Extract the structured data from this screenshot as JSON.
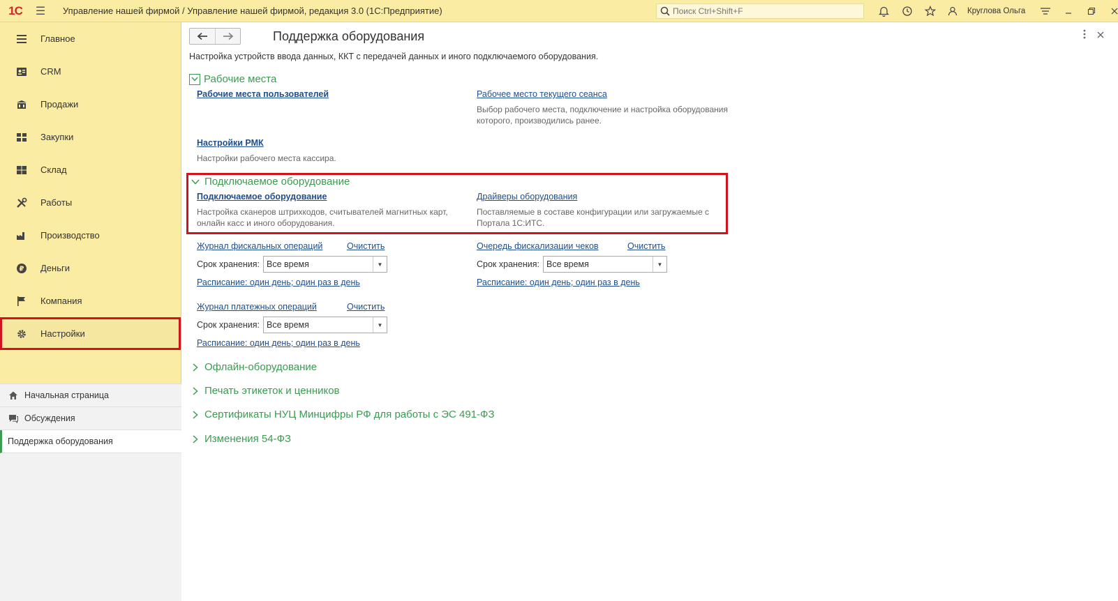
{
  "titlebar": {
    "logo": "1С",
    "app_title": "Управление нашей фирмой / Управление нашей фирмой, редакция 3.0  (1С:Предприятие)",
    "search_placeholder": "Поиск Ctrl+Shift+F",
    "username": "Круглова Ольга"
  },
  "sidebar": {
    "items": [
      {
        "label": "Главное",
        "icon": "menu-icon"
      },
      {
        "label": "CRM",
        "icon": "crm-icon"
      },
      {
        "label": "Продажи",
        "icon": "sales-icon"
      },
      {
        "label": "Закупки",
        "icon": "purchases-icon"
      },
      {
        "label": "Склад",
        "icon": "warehouse-icon"
      },
      {
        "label": "Работы",
        "icon": "tools-icon"
      },
      {
        "label": "Производство",
        "icon": "factory-icon"
      },
      {
        "label": "Деньги",
        "icon": "money-icon"
      },
      {
        "label": "Компания",
        "icon": "flag-icon"
      },
      {
        "label": "Настройки",
        "icon": "gear-icon"
      }
    ],
    "open_windows": [
      {
        "label": "Начальная страница",
        "icon": "home-icon"
      },
      {
        "label": "Обсуждения",
        "icon": "chat-icon"
      },
      {
        "label": "Поддержка оборудования",
        "icon": ""
      }
    ]
  },
  "main": {
    "title": "Поддержка оборудования",
    "description": "Настройка устройств ввода данных, ККТ с передачей данных и иного подключаемого оборудования.",
    "workplaces": {
      "header": "Рабочие места",
      "user_workplaces": "Рабочие места пользователей",
      "current_workplace": "Рабочее место текущего сеанса",
      "current_workplace_note": "Выбор рабочего места, подключение и настройка оборудования которого, производились ранее.",
      "rmk_settings": "Настройки РМК",
      "rmk_note": "Настройки рабочего места кассира."
    },
    "equipment": {
      "header": "Подключаемое оборудование",
      "connected": "Подключаемое оборудование",
      "connected_note": "Настройка сканеров штрихкодов, считывателей магнитных карт, онлайн касс и иного оборудования.",
      "drivers": "Драйверы оборудования",
      "drivers_note": "Поставляемые в составе конфигурации или загружаемые с Портала 1С:ИТС."
    },
    "fiscal_log": {
      "link": "Журнал фискальных операций",
      "clear": "Очистить",
      "storage_label": "Срок хранения:",
      "storage_value": "Все время",
      "schedule": "Расписание: один день; один раз в день"
    },
    "fiscal_queue": {
      "link": "Очередь фискализации чеков",
      "clear": "Очистить",
      "storage_label": "Срок хранения:",
      "storage_value": "Все время",
      "schedule": "Расписание: один день; один раз в день"
    },
    "payment_log": {
      "link": "Журнал платежных операций",
      "clear": "Очистить",
      "storage_label": "Срок хранения:",
      "storage_value": "Все время",
      "schedule": "Расписание: один день; один раз в день"
    },
    "collapsed_groups": [
      "Офлайн-оборудование",
      "Печать этикеток и ценников",
      "Сертификаты НУЦ Минцифры РФ для работы с ЭС 491-ФЗ",
      "Изменения 54-ФЗ"
    ]
  },
  "colors": {
    "accent_green": "#3b9b51",
    "link_blue": "#1f4e8c",
    "highlight_red": "#d0131c",
    "panel_yellow": "#fbeca4"
  }
}
